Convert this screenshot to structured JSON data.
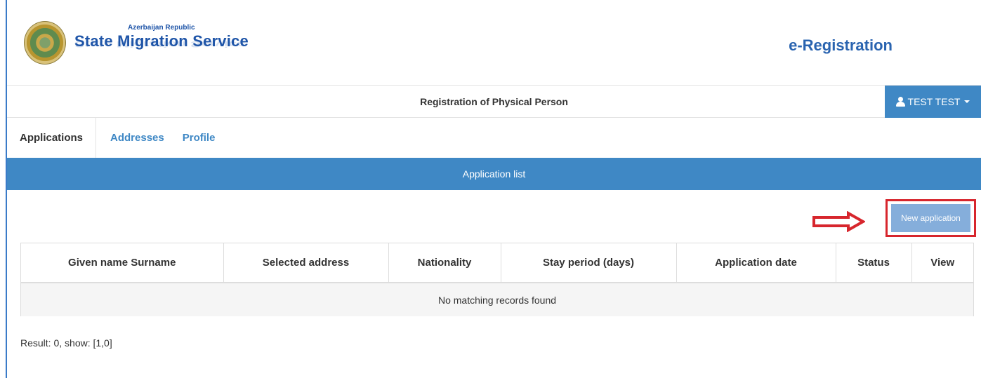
{
  "header": {
    "org_subtitle": "Azerbaijan Republic",
    "org_title": "State Migration Service",
    "app_title": "e-Registration"
  },
  "titlebar": {
    "text": "Registration of Physical Person",
    "user_label": "TEST TEST"
  },
  "tabs": [
    {
      "label": "Applications",
      "active": true
    },
    {
      "label": "Addresses",
      "active": false
    },
    {
      "label": "Profile",
      "active": false
    }
  ],
  "panel": {
    "title": "Application list",
    "new_button_label": "New application"
  },
  "table": {
    "columns": [
      "Given name Surname",
      "Selected address",
      "Nationality",
      "Stay period (days)",
      "Application date",
      "Status",
      "View"
    ],
    "empty_text": "No matching records found"
  },
  "footer": {
    "result_text": "Result: 0, show: [1,0]"
  },
  "colors": {
    "accent": "#3f88c5",
    "button": "#85aedb",
    "highlight": "#d7262d"
  }
}
